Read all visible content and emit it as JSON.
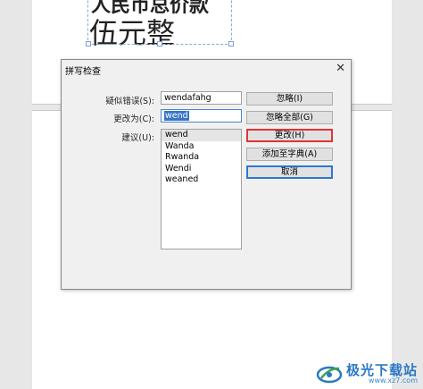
{
  "document": {
    "line1": "人民币总价款",
    "line2": "伍元整"
  },
  "dialog": {
    "title": "拼写检查",
    "close_glyph": "✕",
    "labels": {
      "suspect": "疑似错误(S):",
      "change_to": "更改为(C):",
      "suggestions": "建议(U):"
    },
    "suspect_value": "wendafahg",
    "change_to_value": "wend",
    "suggestions": [
      "wend",
      "Wanda",
      "Rwanda",
      "Wendi",
      "weaned"
    ],
    "buttons": {
      "ignore": "忽略(I)",
      "ignore_all": "忽略全部(G)",
      "change": "更改(H)",
      "add_to_dictionary": "添加至字典(A)",
      "cancel": "取消"
    }
  },
  "watermark": {
    "name": "极光下载站",
    "url": "www.xz7.com"
  },
  "colors": {
    "selection": "#3874c7",
    "highlight_border": "#e03434",
    "default_button_border": "#2d77d1",
    "watermark": "#2a79c4"
  }
}
